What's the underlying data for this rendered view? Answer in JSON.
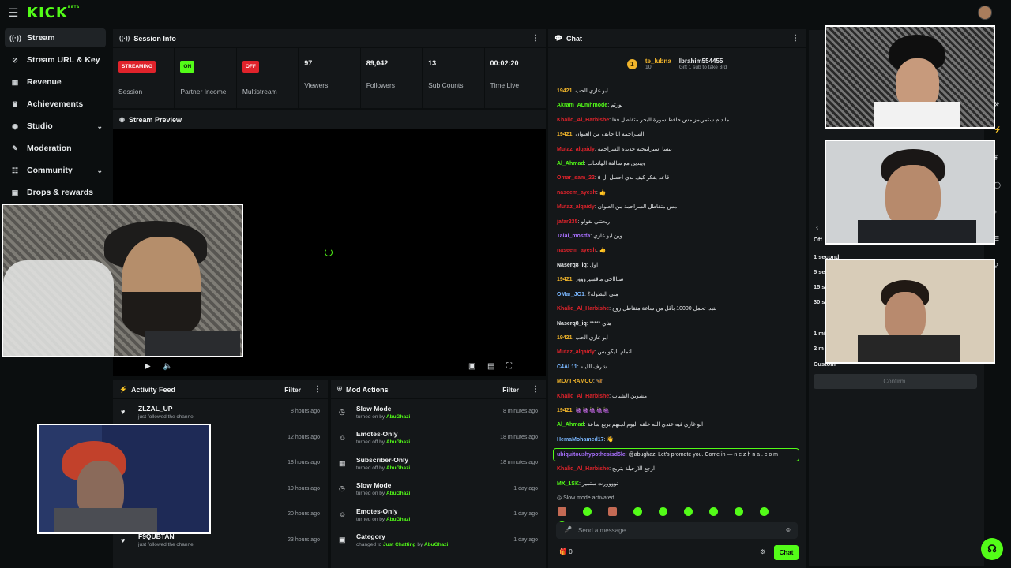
{
  "brand": {
    "logo": "KICK",
    "beta": "BETA"
  },
  "sidebar": {
    "items": [
      {
        "label": "Stream",
        "icon": "broadcast-icon",
        "active": true
      },
      {
        "label": "Stream URL & Key",
        "icon": "link-icon"
      },
      {
        "label": "Revenue",
        "icon": "revenue-icon"
      },
      {
        "label": "Achievements",
        "icon": "trophy-icon"
      },
      {
        "label": "Studio",
        "icon": "studio-icon",
        "expandable": true
      },
      {
        "label": "Moderation",
        "icon": "wrench-icon"
      },
      {
        "label": "Community",
        "icon": "community-icon",
        "expandable": true
      },
      {
        "label": "Drops & rewards",
        "icon": "gift-icon"
      }
    ]
  },
  "session": {
    "title": "Session Info",
    "stats": [
      {
        "value": "STREAMING",
        "label": "Session",
        "kind": "badge-red"
      },
      {
        "value": "ON",
        "label": "Partner Income",
        "kind": "badge-green"
      },
      {
        "value": "OFF",
        "label": "Multistream",
        "kind": "badge-red"
      },
      {
        "value": "97",
        "label": "Viewers"
      },
      {
        "value": "89,042",
        "label": "Followers"
      },
      {
        "value": "13",
        "label": "Sub Counts"
      },
      {
        "value": "00:02:20",
        "label": "Time Live"
      }
    ]
  },
  "preview": {
    "title": "Stream Preview"
  },
  "activity": {
    "title": "Activity Feed",
    "filter": "Filter",
    "rows": [
      {
        "name": "ZLZAL_UP",
        "sub": "just followed the channel",
        "time": "8 hours ago"
      },
      {
        "name": "",
        "sub": "",
        "time": "12 hours ago"
      },
      {
        "name": "",
        "sub": "",
        "time": "18 hours ago"
      },
      {
        "name": "",
        "sub": "",
        "time": "19 hours ago"
      },
      {
        "name": "",
        "sub": "",
        "time": "20 hours ago"
      },
      {
        "name": "F9QUBTAN",
        "sub": "just followed the channel",
        "time": "23 hours ago"
      }
    ]
  },
  "mod": {
    "title": "Mod Actions",
    "filter": "Filter",
    "rows": [
      {
        "name": "Slow Mode",
        "action": "turned on by",
        "by": "AbuGhazi",
        "time": "8 minutes ago"
      },
      {
        "name": "Emotes-Only",
        "action": "turned off by",
        "by": "AbuGhazi",
        "time": "18 minutes ago"
      },
      {
        "name": "Subscriber-Only",
        "action": "turned off by",
        "by": "AbuGhazi",
        "time": "18 minutes ago"
      },
      {
        "name": "Slow Mode",
        "action": "turned on by",
        "by": "AbuGhazi",
        "time": "1 day ago"
      },
      {
        "name": "Emotes-Only",
        "action": "turned on by",
        "by": "AbuGhazi",
        "time": "1 day ago"
      },
      {
        "name": "Category",
        "action": "changed to",
        "by": "Just Chatting",
        "by2": "by",
        "by3": "AbuGhazi",
        "time": "1 day ago"
      }
    ]
  },
  "chat": {
    "title": "Chat",
    "top_user1": "te_lubna",
    "top_user1_count": "10",
    "top_user2": "Ibrahim554455",
    "gift_note": "Gift 1 sub to take 3rd",
    "messages": [
      {
        "user": "19421",
        "color": "#f0b42b",
        "text": "ابو غازي الحب"
      },
      {
        "user": "Akram_ALmhmode",
        "color": "#53fc18",
        "text": "نورتم"
      },
      {
        "user": "Khalid_Al_Harbishe",
        "color": "#e0232b",
        "text": "ما دام ستمريمز مش حافظ سورة البحر متقاطل قفا"
      },
      {
        "user": "19421",
        "color": "#f0b42b",
        "text": "السراحمة انا خايف من العنوان"
      },
      {
        "user": "Mutaz_alqaidy",
        "color": "#e0232b",
        "text": "ينسا استراتيجية جديدة السراحمة"
      },
      {
        "user": "Al_Ahmad",
        "color": "#53fc18",
        "text": "ويبدين مع سالفة الهاتجات"
      },
      {
        "user": "Omar_sam_22",
        "color": "#e0232b",
        "text": "قاعد بفكر كيف بدي احصل ال ٥"
      },
      {
        "user": "naseem_ayesh",
        "color": "#e0232b",
        "text": "👍"
      },
      {
        "user": "Mutaz_alqaidy",
        "color": "#e0232b",
        "text": "مش متقاطل السراحمة من العنوان"
      },
      {
        "user": "jafar235",
        "color": "#e0232b",
        "text": "ربحتني بقولو"
      },
      {
        "user": "Talal_mostfa",
        "color": "#a970ff",
        "text": "وين ابو غازي"
      },
      {
        "user": "naseem_ayesh",
        "color": "#e0232b",
        "text": "👍"
      },
      {
        "user": "Naserq8_iq",
        "color": "#e6e8ea",
        "text": "اول"
      },
      {
        "user": "19421",
        "color": "#f0b42b",
        "text": "صباااحي ماقسيرووور"
      },
      {
        "user": "OMar_JO1",
        "color": "#7ab7ff",
        "text": "مني البطولة؟"
      },
      {
        "user": "Khalid_Al_Harbishe",
        "color": "#e0232b",
        "text": "بنبدا تحمل 10000 بأقل من ساعة متقاطل روح"
      },
      {
        "user": "Naserq8_iq",
        "color": "#e6e8ea",
        "text": "***** هاي"
      },
      {
        "user": "19421",
        "color": "#f0b42b",
        "text": "ابو غازي الحب"
      },
      {
        "user": "Mutaz_alqaidy",
        "color": "#e0232b",
        "text": "اتمام بليكو بس"
      },
      {
        "user": "C4AL11",
        "color": "#7ab7ff",
        "text": "شرف الليله"
      },
      {
        "user": "MO7TRAMCO",
        "color": "#f0b42b",
        "text": "🦋"
      },
      {
        "user": "Khalid_Al_Harbishe",
        "color": "#e0232b",
        "text": "مشوين الشباب"
      },
      {
        "user": "19421",
        "color": "#f0b42b",
        "text": "🍇🍇🍇🍇🍇"
      },
      {
        "user": "Al_Ahmad",
        "color": "#53fc18",
        "text": "ابو غازي فيه عندي الله خلقه اليوم لجبهم بربع ساعة"
      },
      {
        "user": "HemaMohamed17",
        "color": "#7ab7ff",
        "text": "👋"
      },
      {
        "user": "ubiquitoushypothesisd5le",
        "color": "#a970ff",
        "text": "@abughazi Let's promote you. Come in — n e z h n a . c o m",
        "highlight": true
      },
      {
        "user": "Khalid_Al_Harbishe",
        "color": "#e0232b",
        "text": "ارجع للارجيلة بتربح"
      },
      {
        "user": "MX_1SK",
        "color": "#53fc18",
        "text": "نوووورت ستمير"
      }
    ],
    "slow_mode": "Slow mode activated",
    "placeholder": "Send a message",
    "count": "0",
    "send": "Chat"
  },
  "slowmode_panel": {
    "options": [
      "Off",
      "1 second",
      "5 se",
      "15 s",
      "30 s",
      "1 mi",
      "2 m",
      "Custom"
    ],
    "confirm": "Confirm."
  }
}
